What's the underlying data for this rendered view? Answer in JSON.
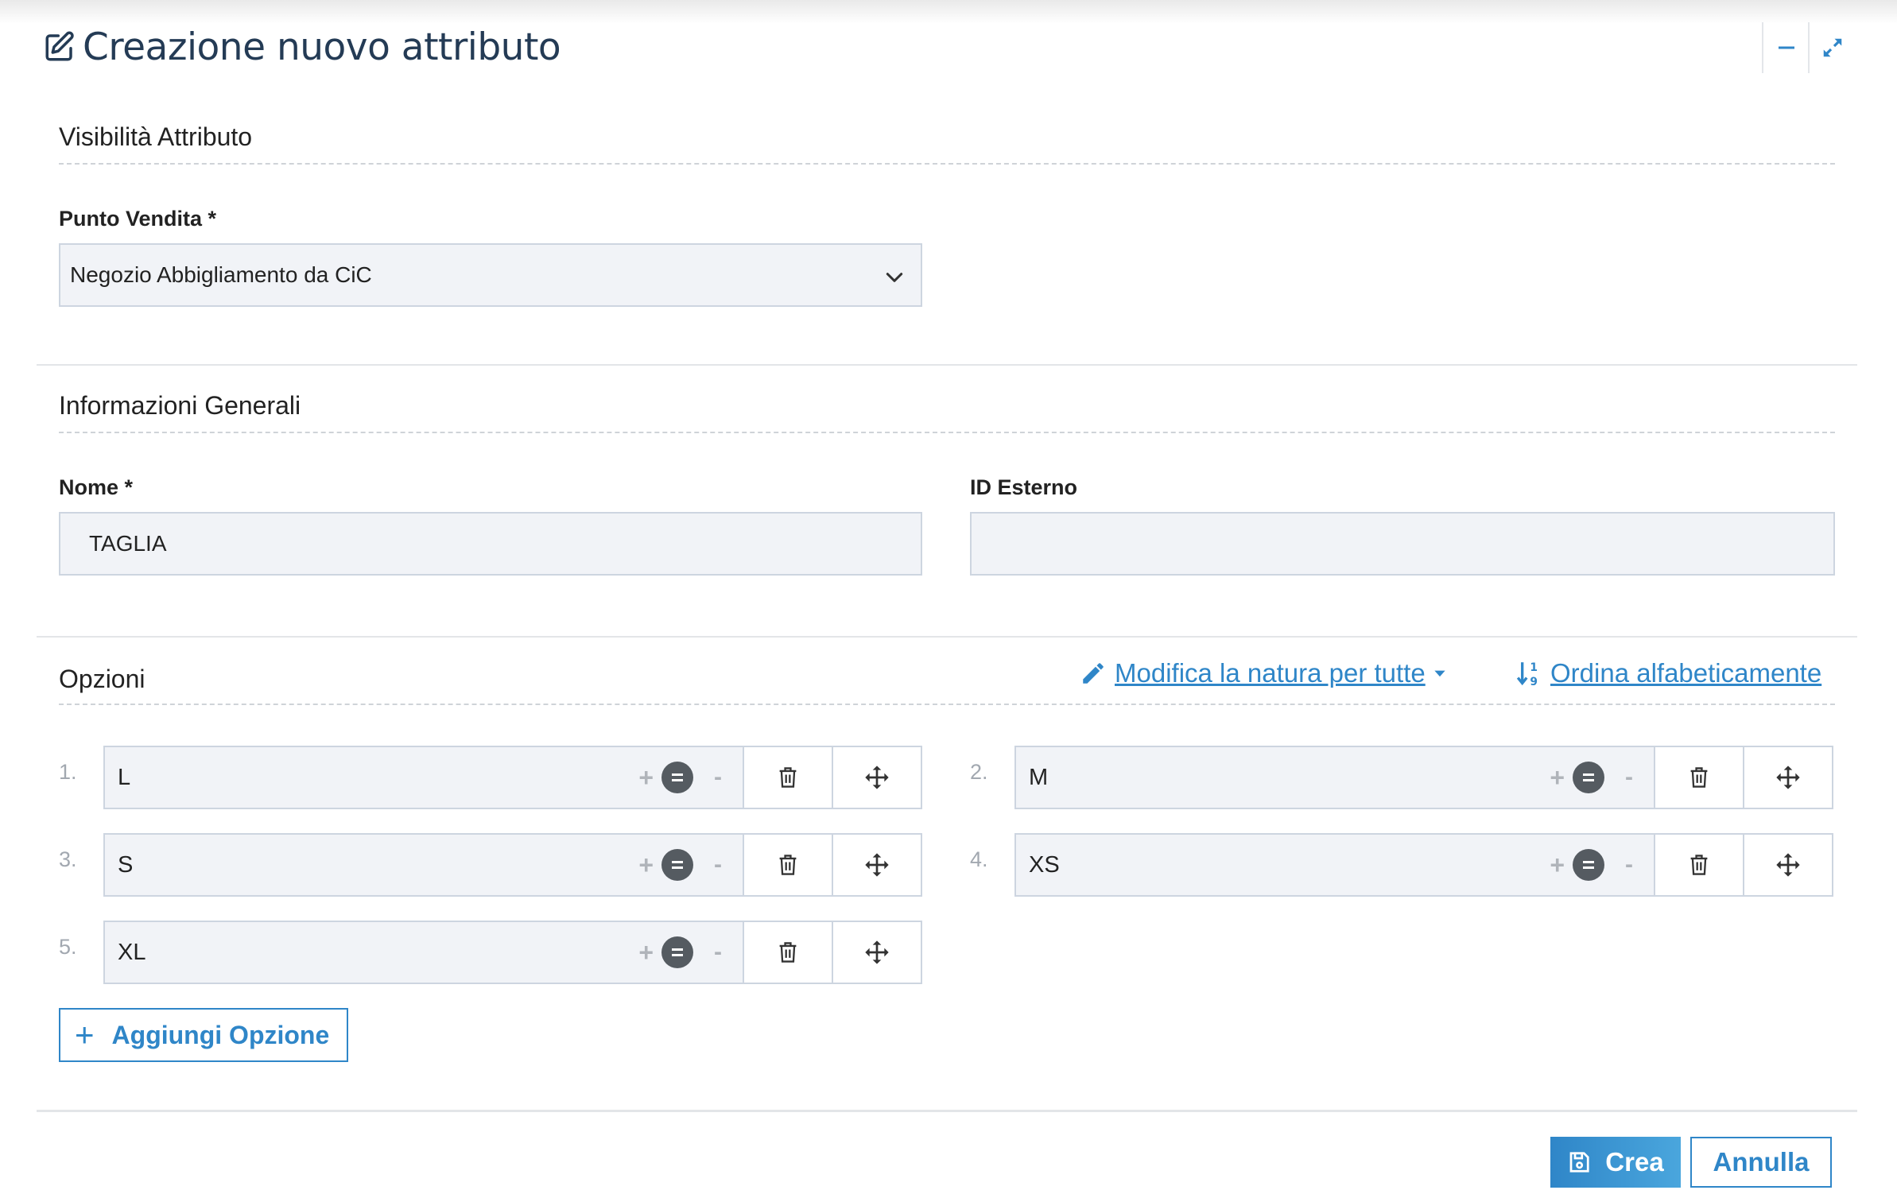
{
  "header": {
    "title": "Creazione nuovo attributo",
    "title_icon": "edit-icon",
    "minimize_icon": "minus-icon",
    "expand_icon": "expand-icon"
  },
  "visibility": {
    "section_title": "Visibilità Attributo",
    "store_label": "Punto Vendita *",
    "store_value": "Negozio Abbigliamento da CiC"
  },
  "general": {
    "section_title": "Informazioni Generali",
    "name_label": "Nome *",
    "name_value": "TAGLIA",
    "external_id_label": "ID Esterno",
    "external_id_value": ""
  },
  "options": {
    "section_title": "Opzioni",
    "edit_nature_link": "Modifica la natura per tutte",
    "sort_link": "Ordina alfabeticamente",
    "plus_symbol": "+",
    "minus_symbol": "-",
    "items": [
      {
        "number": "1.",
        "value": "L"
      },
      {
        "number": "2.",
        "value": "M"
      },
      {
        "number": "3.",
        "value": "S"
      },
      {
        "number": "4.",
        "value": "XS"
      },
      {
        "number": "5.",
        "value": "XL"
      }
    ],
    "add_button": "Aggiungi Opzione"
  },
  "footer": {
    "create_button": "Crea",
    "cancel_button": "Annulla"
  },
  "colors": {
    "accent": "#2f86c8",
    "title": "#243b55",
    "field_bg": "#f1f3f7"
  }
}
